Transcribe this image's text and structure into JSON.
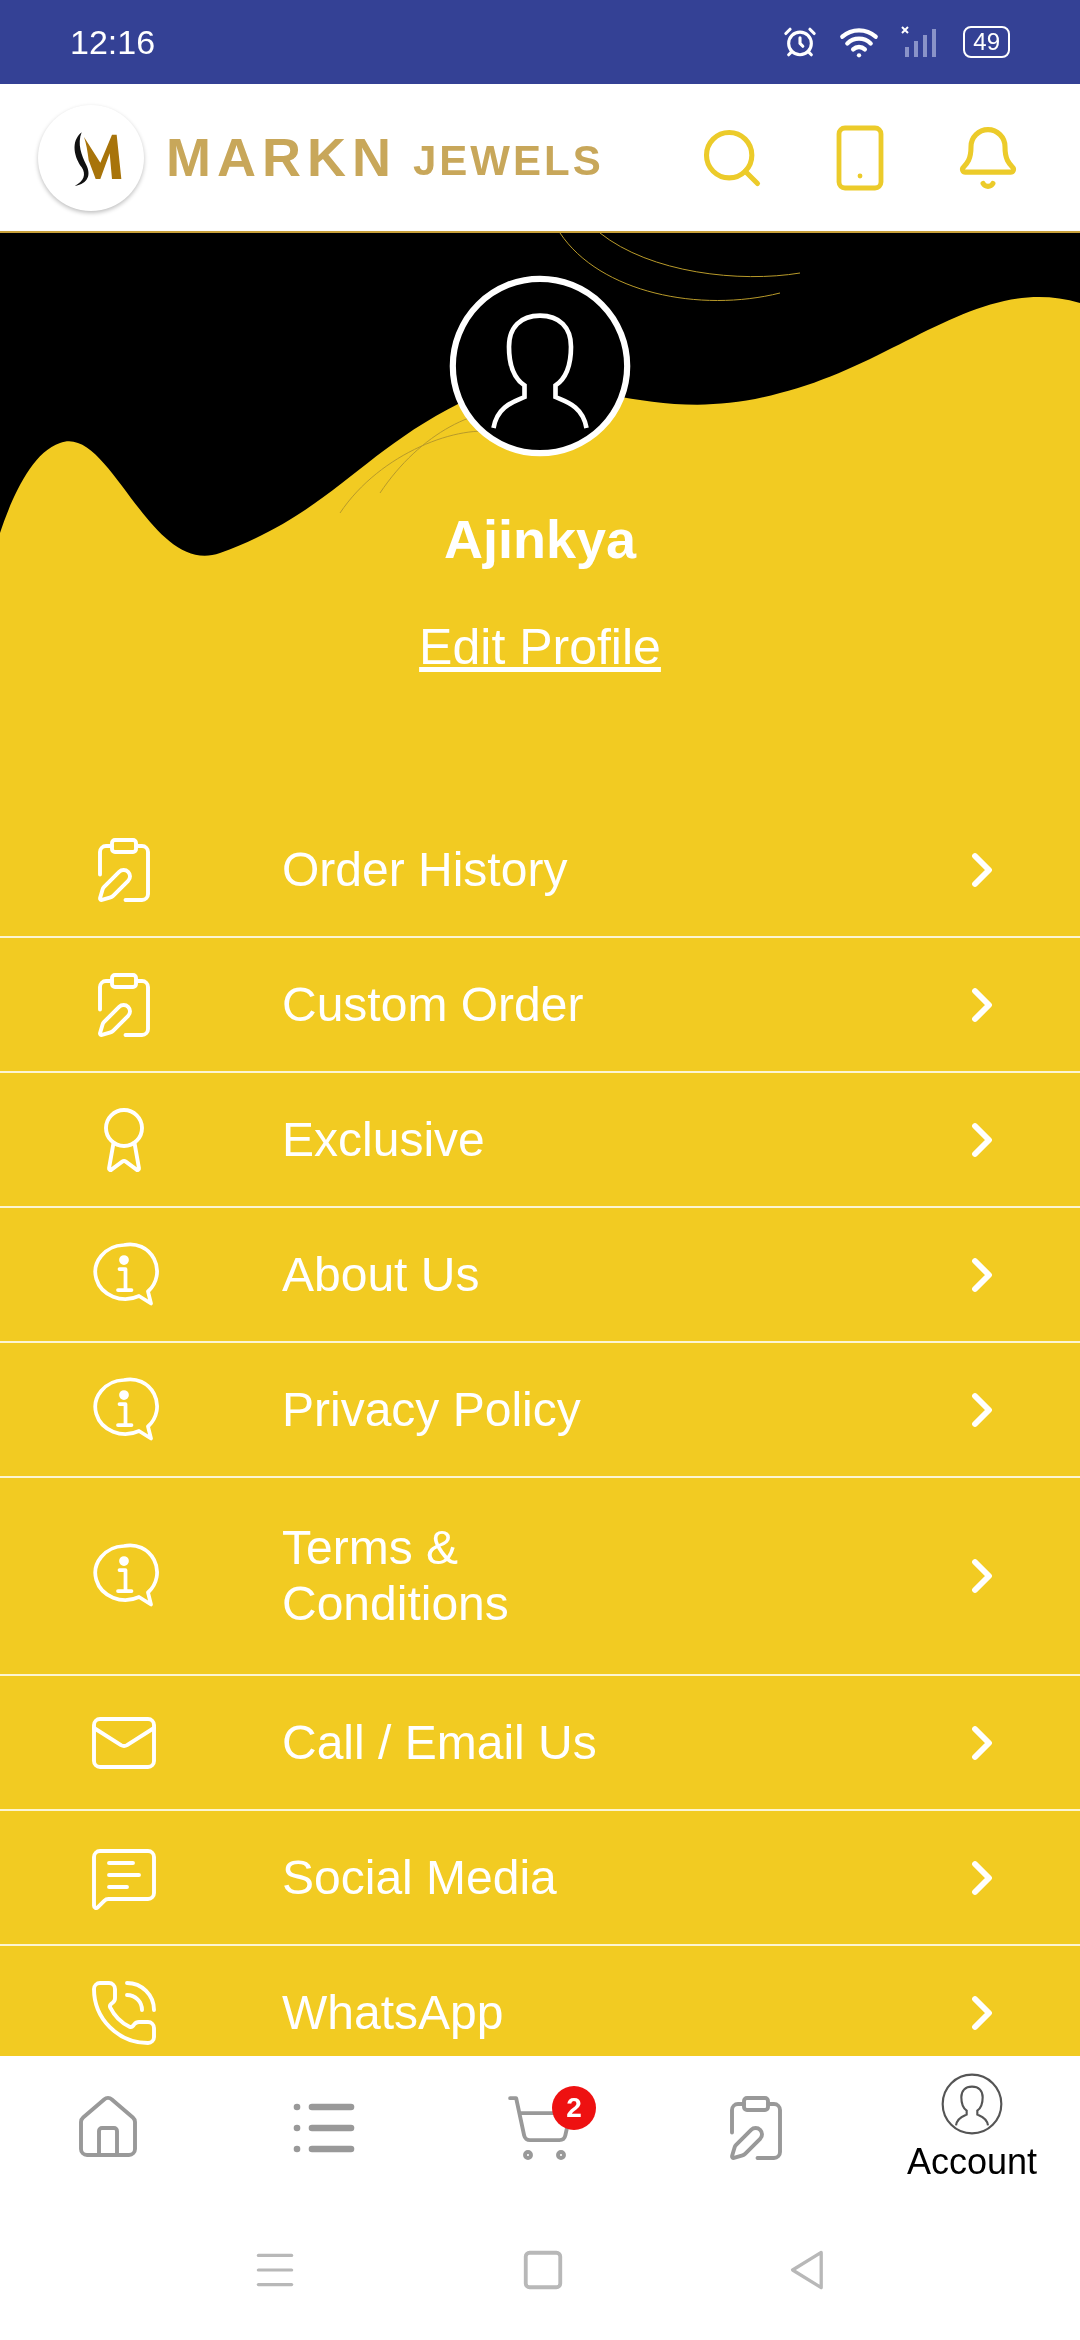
{
  "status_bar": {
    "time": "12:16",
    "battery": "49"
  },
  "header": {
    "brand": "MARKN",
    "brand_suffix": "JEWELS"
  },
  "profile": {
    "name": "Ajinkya",
    "edit_link": "Edit Profile"
  },
  "menu": [
    {
      "label": "Order History",
      "kind": "clipboard"
    },
    {
      "label": "Custom Order",
      "kind": "clipboard"
    },
    {
      "label": "Exclusive",
      "kind": "award"
    },
    {
      "label": "About Us",
      "kind": "info"
    },
    {
      "label": "Privacy Policy",
      "kind": "info"
    },
    {
      "label": "Terms &\nConditions",
      "kind": "info"
    },
    {
      "label": "Call / Email Us",
      "kind": "mail"
    },
    {
      "label": "Social Media",
      "kind": "chat"
    },
    {
      "label": "WhatsApp",
      "kind": "phone"
    }
  ],
  "bottom_nav": [
    {
      "kind": "home",
      "selected": false
    },
    {
      "kind": "list",
      "selected": false
    },
    {
      "kind": "cart",
      "selected": false,
      "badge": "2"
    },
    {
      "kind": "orders",
      "selected": false
    },
    {
      "kind": "account",
      "selected": true,
      "label": "Account"
    }
  ]
}
